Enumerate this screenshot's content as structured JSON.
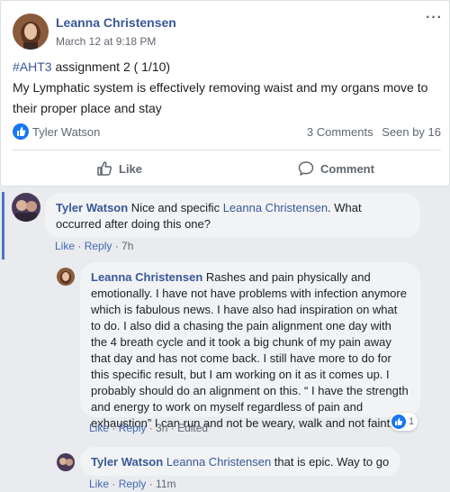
{
  "post": {
    "author": "Leanna Christensen",
    "date": "March 12 at 9:18 PM",
    "more": "···",
    "hashtag": "#AHT3",
    "title_rest": " assignment 2 ( 1/10)",
    "body": "My Lymphatic system is effectively removing waist and my organs move to their proper place and stay",
    "reactor": "Tyler Watson",
    "comments_count": "3 Comments",
    "seen_by": "Seen by 16",
    "like_label": "Like",
    "comment_label": "Comment"
  },
  "comments": [
    {
      "author": "Tyler Watson",
      "mention": "",
      "text": " Nice and specific ",
      "mention2": "Leanna Christensen",
      "text2": ". What occurred after doing this one?",
      "like": "Like",
      "reply": "Reply",
      "time": "7h"
    },
    {
      "author": "Leanna Christensen",
      "text": " Rashes and pain physically and emotionally. I have not have problems with infection anymore which is fabulous news. I have also had inspiration on what to do. I also did a chasing the pain alignment one day with the 4 breath cycle and it took a big chunk of my pain away that day and has not come back. I still have more to do for this specific result, but I am working on it as it comes up. I probably should do an alignment on this. “ I have the strength and energy to work on myself regardless of pain and exhaustion” I can run and not be weary, walk and not faint.”",
      "like": "Like",
      "reply": "Reply",
      "time": "3h",
      "edited": "Edited",
      "reaction_count": "1"
    },
    {
      "author": "Tyler Watson",
      "mention": "Leanna Christensen",
      "text": " that is epic. Way to go",
      "like": "Like",
      "reply": "Reply",
      "time": "11m"
    }
  ],
  "icons": {
    "like_badge": "thumbs-up-icon",
    "like_action": "thumbs-up-outline-icon",
    "comment_action": "speech-bubble-icon"
  },
  "colors": {
    "link": "#385898",
    "accent": "#1877f2",
    "muted": "#606770",
    "bubble": "#f2f3f5"
  }
}
